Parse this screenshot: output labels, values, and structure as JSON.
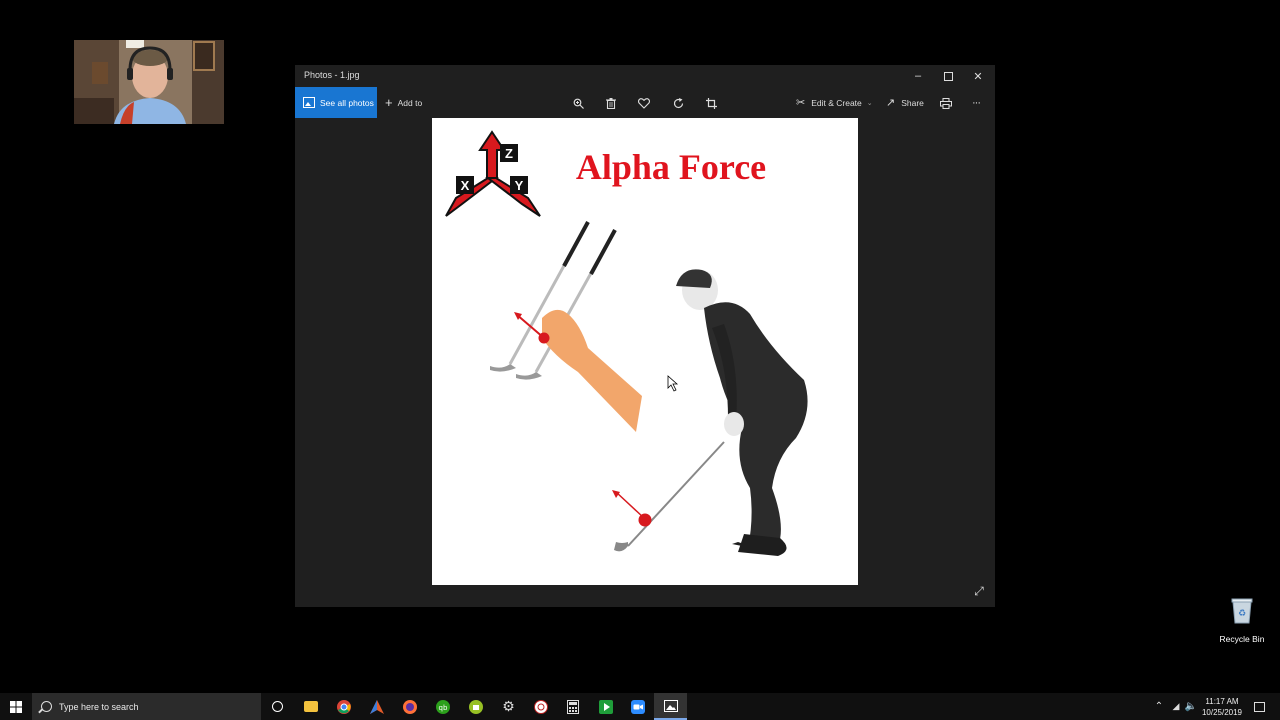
{
  "window": {
    "title": "Photos - 1.jpg",
    "minimize_icon": "minimize-icon",
    "maximize_icon": "maximize-icon",
    "close_icon": "close-icon"
  },
  "toolbar": {
    "see_all_photos": "See all photos",
    "add_to": "Add to",
    "edit_create": "Edit & Create",
    "share": "Share",
    "more": "···",
    "icons": [
      "zoom-icon",
      "delete-icon",
      "favorite-icon",
      "rotate-icon",
      "crop-icon",
      "print-icon"
    ]
  },
  "photo": {
    "title": "Alpha Force",
    "axes": [
      "Z",
      "X",
      "Y"
    ],
    "title_color": "#e0141e",
    "accent_red": "#d7191e"
  },
  "desktop": {
    "recycle_bin_label": "Recycle Bin"
  },
  "taskbar": {
    "search_placeholder": "Type here to search",
    "apps": [
      "task-view-icon",
      "file-explorer-icon",
      "chrome-icon",
      "app-icon",
      "firefox-icon",
      "quickbooks-icon",
      "android-icon",
      "settings-icon",
      "app-icon",
      "calculator-icon",
      "camtasia-icon",
      "zoom-icon",
      "photos-icon"
    ],
    "time": "11:17 AM",
    "date": "10/25/2019"
  },
  "colors": {
    "window_bg": "#1f1f1f",
    "accent_blue": "#1976d2"
  }
}
